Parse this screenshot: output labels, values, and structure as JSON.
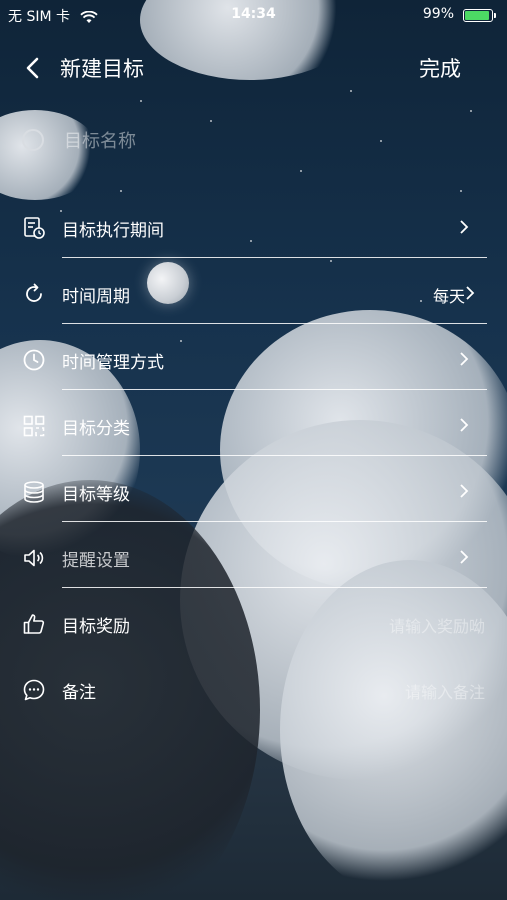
{
  "status_bar": {
    "carrier": "无 SIM 卡",
    "time": "14:34",
    "battery": "99%",
    "battery_color": "#4cd964"
  },
  "nav": {
    "title": "新建目标",
    "done_label": "完成",
    "back_icon": "chevron-left-icon"
  },
  "name_input": {
    "placeholder": "目标名称",
    "value": ""
  },
  "rows": [
    {
      "label": "目标执行期间",
      "icon": "calendar-clock-icon",
      "value": "",
      "placeholder": ""
    },
    {
      "label": "时间周期",
      "icon": "refresh-icon",
      "value": "每天",
      "placeholder": ""
    },
    {
      "label": "时间管理方式",
      "icon": "clock-icon",
      "value": "",
      "placeholder": ""
    },
    {
      "label": "目标分类",
      "icon": "category-grid-icon",
      "value": "",
      "placeholder": ""
    },
    {
      "label": "目标等级",
      "icon": "database-icon",
      "value": "",
      "placeholder": ""
    },
    {
      "label": "提醒设置",
      "icon": "speaker-icon",
      "value": "",
      "placeholder": ""
    },
    {
      "label": "目标奖励",
      "icon": "thumbs-up-icon",
      "value": "",
      "placeholder": "请输入奖励呦"
    },
    {
      "label": "备注",
      "icon": "chat-bubble-icon",
      "value": "",
      "placeholder": "请输入备注"
    }
  ]
}
